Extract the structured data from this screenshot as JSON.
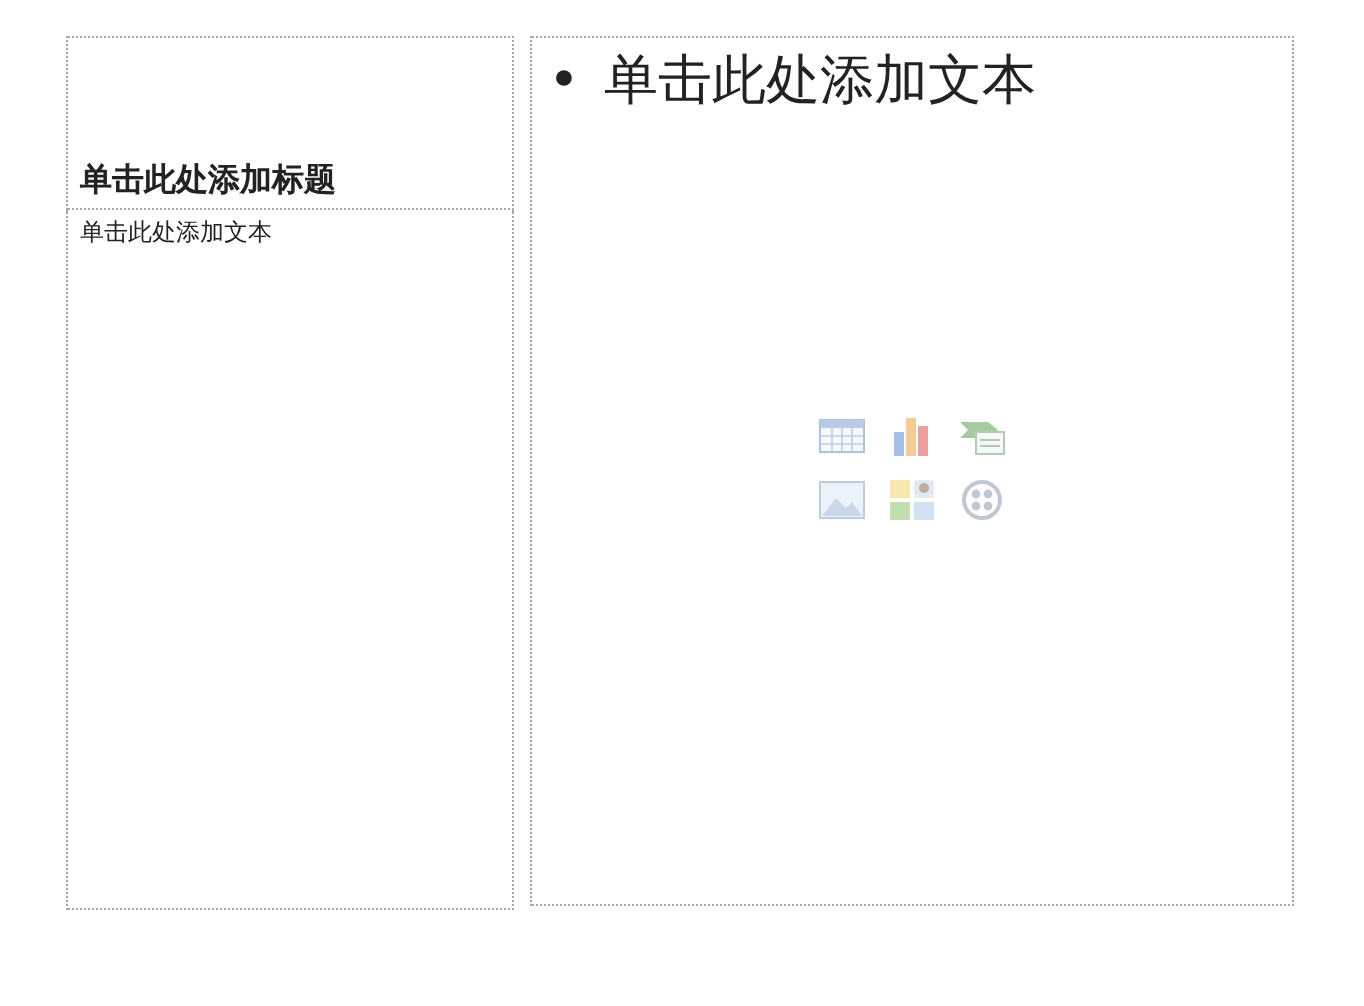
{
  "left_title_placeholder": {
    "text": "单击此处添加标题"
  },
  "left_text_placeholder": {
    "text": "单击此处添加文本"
  },
  "right_content_placeholder": {
    "bullet": "•",
    "text": "单击此处添加文本"
  }
}
